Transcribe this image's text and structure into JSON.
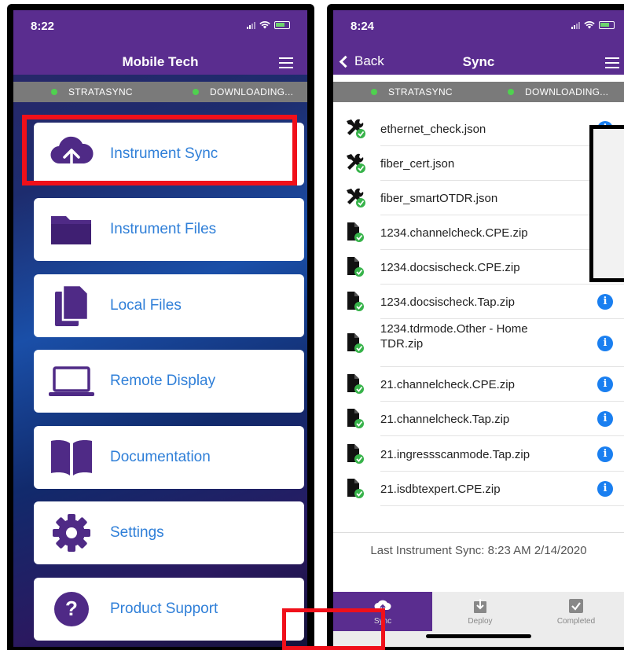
{
  "left_screen": {
    "status": {
      "time": "8:22"
    },
    "header": {
      "title": "Mobile Tech"
    },
    "connection": {
      "left": "STRATASYNC",
      "right": "DOWNLOADING..."
    },
    "menu": [
      {
        "label": "Instrument Sync",
        "icon": "cloud-upload-icon"
      },
      {
        "label": "Instrument Files",
        "icon": "folder-icon"
      },
      {
        "label": "Local Files",
        "icon": "files-icon"
      },
      {
        "label": "Remote Display",
        "icon": "laptop-icon"
      },
      {
        "label": "Documentation",
        "icon": "book-icon"
      },
      {
        "label": "Settings",
        "icon": "gear-icon"
      },
      {
        "label": "Product Support",
        "icon": "question-icon"
      }
    ]
  },
  "right_screen": {
    "status": {
      "time": "8:24"
    },
    "header": {
      "back_label": "Back",
      "title": "Sync"
    },
    "connection": {
      "left": "STRATASYNC",
      "right": "DOWNLOADING..."
    },
    "files": [
      {
        "name": "ethernet_check.json",
        "type": "tool",
        "info": true
      },
      {
        "name": "fiber_cert.json",
        "type": "tool",
        "info": false
      },
      {
        "name": "fiber_smartOTDR.json",
        "type": "tool",
        "info": false
      },
      {
        "name": "1234.channelcheck.CPE.zip",
        "type": "file",
        "info": false
      },
      {
        "name": "1234.docsischeck.CPE.zip",
        "type": "file",
        "info": false
      },
      {
        "name": "1234.docsischeck.Tap.zip",
        "type": "file",
        "info": true
      },
      {
        "name": "1234.tdrmode.Other - Home TDR.zip",
        "type": "file",
        "info": true
      },
      {
        "name": "21.channelcheck.CPE.zip",
        "type": "file",
        "info": true
      },
      {
        "name": "21.channelcheck.Tap.zip",
        "type": "file",
        "info": true
      },
      {
        "name": "21.ingressscanmode.Tap.zip",
        "type": "file",
        "info": true
      },
      {
        "name": "21.isdbtexpert.CPE.zip",
        "type": "file",
        "info": true
      }
    ],
    "info_glyph": "i",
    "last_sync": "Last Instrument Sync: 8:23 AM 2/14/2020",
    "tabs": [
      {
        "label": "Sync",
        "active": true
      },
      {
        "label": "Deploy",
        "active": false
      },
      {
        "label": "Completed",
        "active": false
      }
    ]
  },
  "colors": {
    "header_purple": "#5a2d8f",
    "link_blue": "#2f7fd8",
    "highlight_red": "#f0101a",
    "status_green": "#4fd14f"
  }
}
